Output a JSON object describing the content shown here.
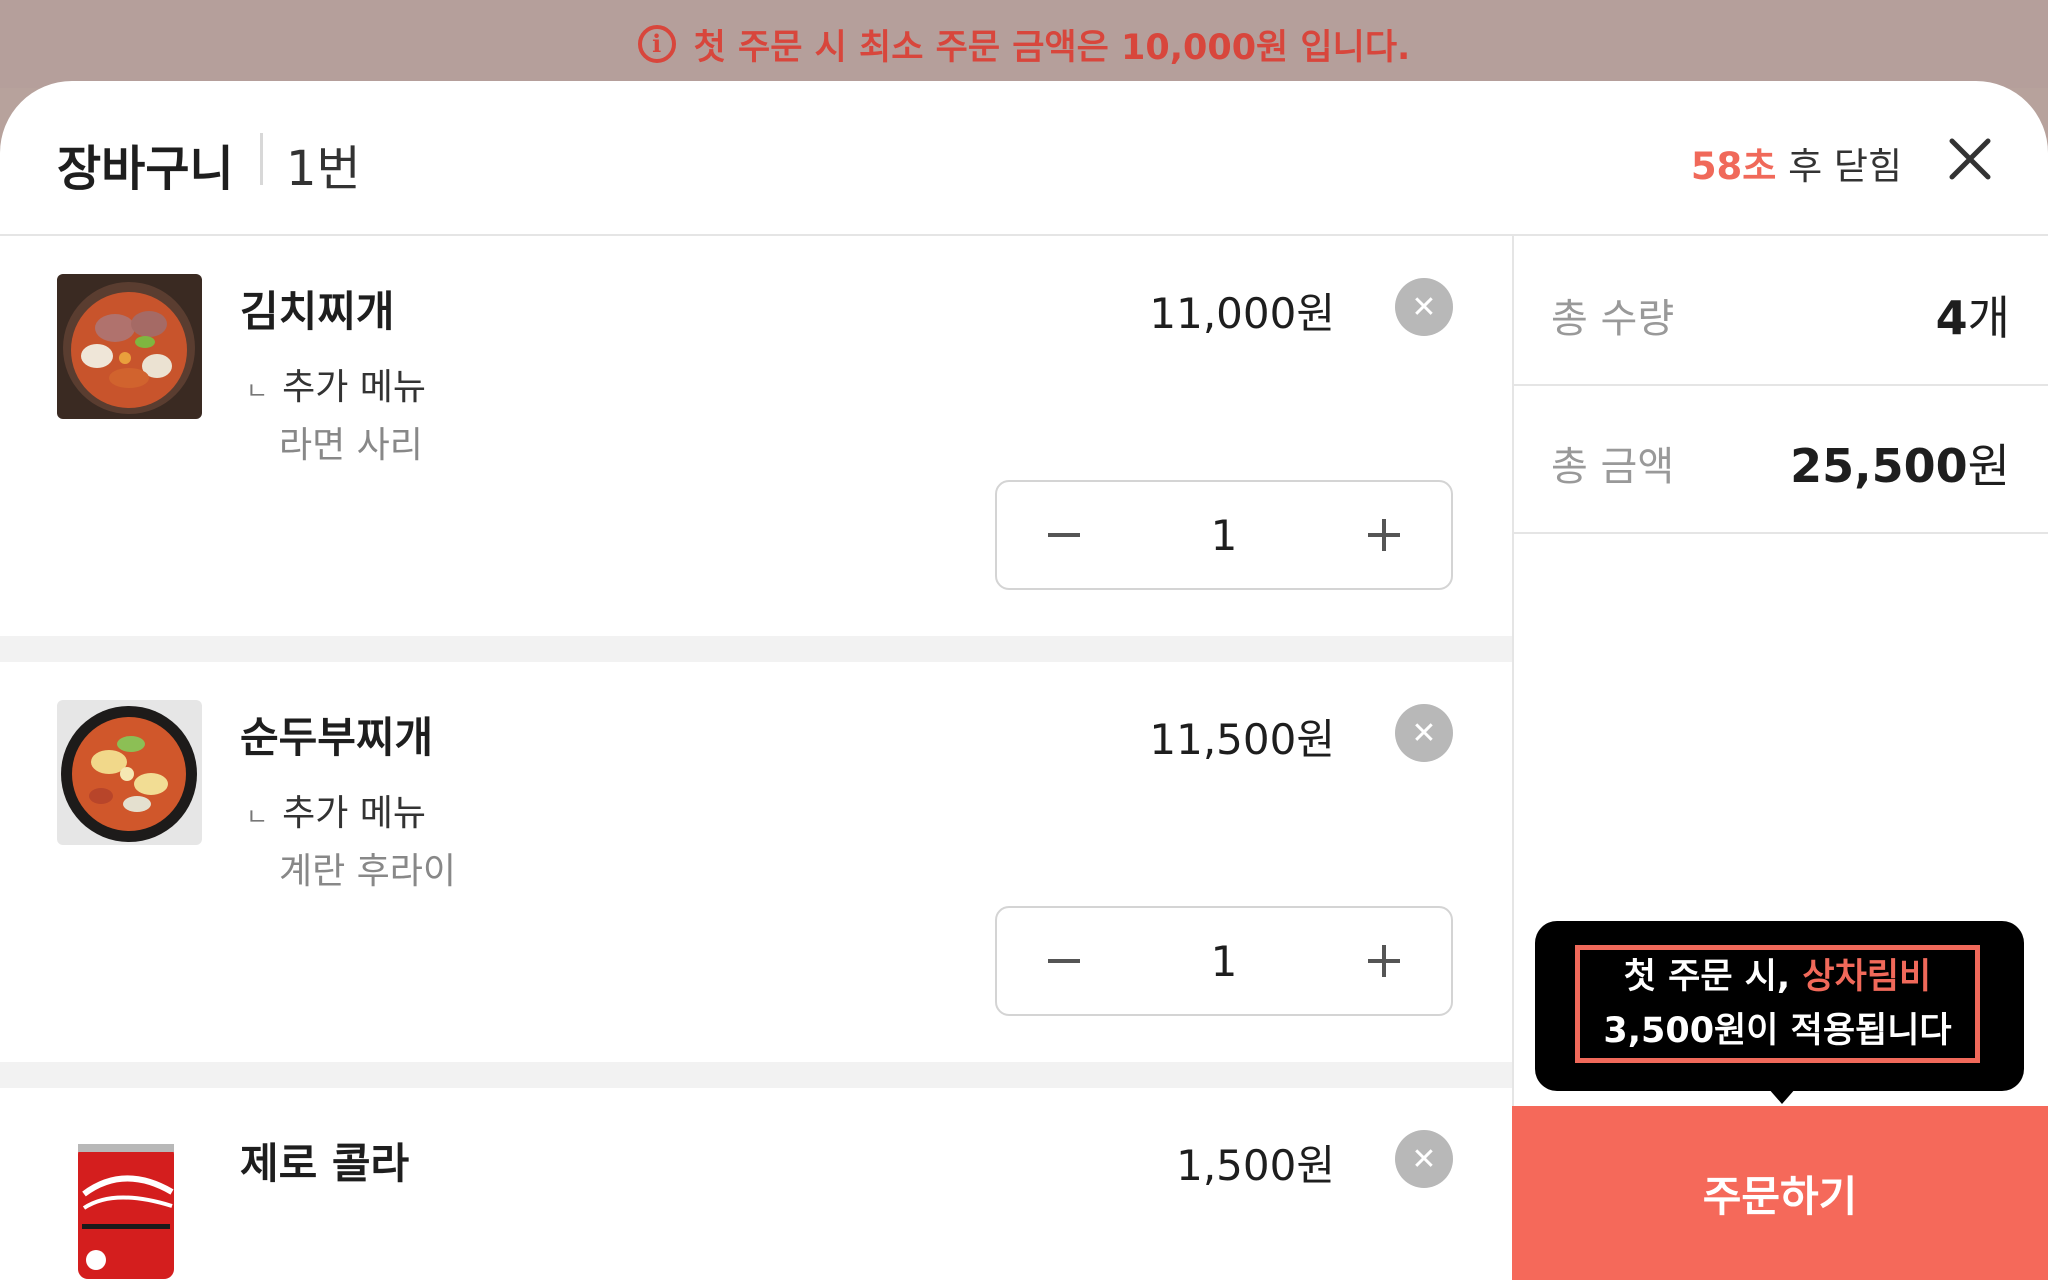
{
  "banner": {
    "text": "첫 주문 시 최소 주문 금액은 10,000원 입니다.",
    "icon": "info-icon"
  },
  "header": {
    "title": "장바구니",
    "cart_number": "1번",
    "countdown_seconds": "58초",
    "countdown_suffix": " 후 닫힘"
  },
  "items": [
    {
      "name": "김치찌개",
      "price": "11,000원",
      "option_label": "추가 메뉴",
      "option_value": "라면 사리",
      "quantity": "1"
    },
    {
      "name": "순두부찌개",
      "price": "11,500원",
      "option_label": "추가 메뉴",
      "option_value": "계란 후라이",
      "quantity": "1"
    },
    {
      "name": "제로 콜라",
      "price": "1,500원"
    }
  ],
  "summary": {
    "qty_label": "총 수량",
    "qty_value": "4",
    "qty_unit": "개",
    "amount_label": "총 금액",
    "amount_value": "25,500",
    "amount_unit": "원"
  },
  "tooltip": {
    "line1_prefix": "첫 주문 시, ",
    "line1_highlight": "상차림비",
    "line2": "3,500원이 적용됩니다"
  },
  "order_button": "주문하기",
  "colors": {
    "accent": "#f5695a",
    "banner_bg": "#b59f9b",
    "banner_text": "#d8463c"
  }
}
